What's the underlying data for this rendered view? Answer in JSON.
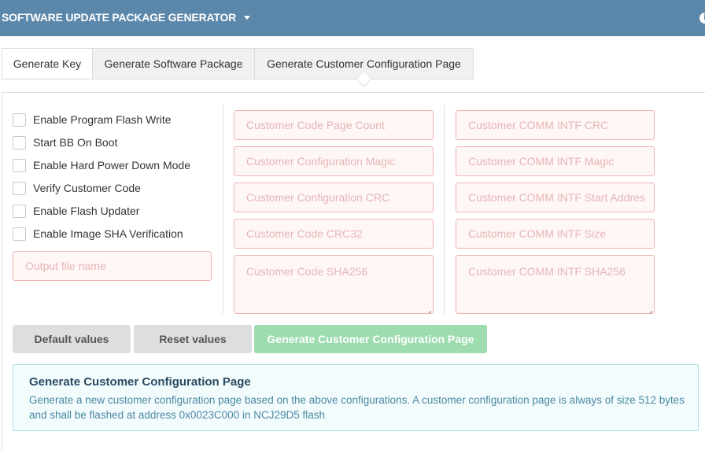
{
  "header": {
    "title": "SOFTWARE UPDATE PACKAGE GENERATOR",
    "title_icon": "chevron-down-icon",
    "right_icon": "info-icon"
  },
  "tabs": [
    {
      "label": "Generate Key",
      "active": false
    },
    {
      "label": "Generate Software Package",
      "active": false
    },
    {
      "label": "Generate Customer Configuration Page",
      "active": true
    }
  ],
  "checkboxes": [
    {
      "label": "Enable Program Flash Write",
      "checked": false
    },
    {
      "label": "Start BB On Boot",
      "checked": false
    },
    {
      "label": "Enable Hard Power Down Mode",
      "checked": false
    },
    {
      "label": "Verify Customer Code",
      "checked": false
    },
    {
      "label": "Enable Flash Updater",
      "checked": false
    },
    {
      "label": "Enable Image SHA Verification",
      "checked": false
    }
  ],
  "output_file": {
    "placeholder": "Output file name",
    "value": ""
  },
  "customer_fields": [
    {
      "placeholder": "Customer Code Page Count",
      "value": ""
    },
    {
      "placeholder": "Customer Configuration Magic",
      "value": ""
    },
    {
      "placeholder": "Customer Configuration CRC",
      "value": ""
    },
    {
      "placeholder": "Customer Code CRC32",
      "value": ""
    },
    {
      "placeholder": "Customer Code SHA256",
      "value": ""
    }
  ],
  "comm_fields": [
    {
      "placeholder": "Customer COMM INTF CRC",
      "value": ""
    },
    {
      "placeholder": "Customer COMM INTF Magic",
      "value": ""
    },
    {
      "placeholder": "Customer COMM INTF Start Addres",
      "value": ""
    },
    {
      "placeholder": "Customer COMM INTF Size",
      "value": ""
    },
    {
      "placeholder": "Customer COMM INTF SHA256",
      "value": ""
    }
  ],
  "buttons": {
    "default": "Default values",
    "reset": "Reset values",
    "generate": "Generate Customer Configuration Page"
  },
  "info": {
    "title": "Generate Customer Configuration Page",
    "text": "Generate a new customer configuration page based on the above configurations. A customer configuration page is always of size 512 bytes and shall be flashed at address 0x0023C000 in NCJ29D5 flash"
  },
  "colors": {
    "header_bg": "#5b87aa",
    "field_border_invalid": "#f0b3b3",
    "field_bg_invalid": "#fff6f6",
    "generate_button": "#9ddcae",
    "info_bg": "#f3fcfd",
    "info_border": "#aadee5"
  }
}
